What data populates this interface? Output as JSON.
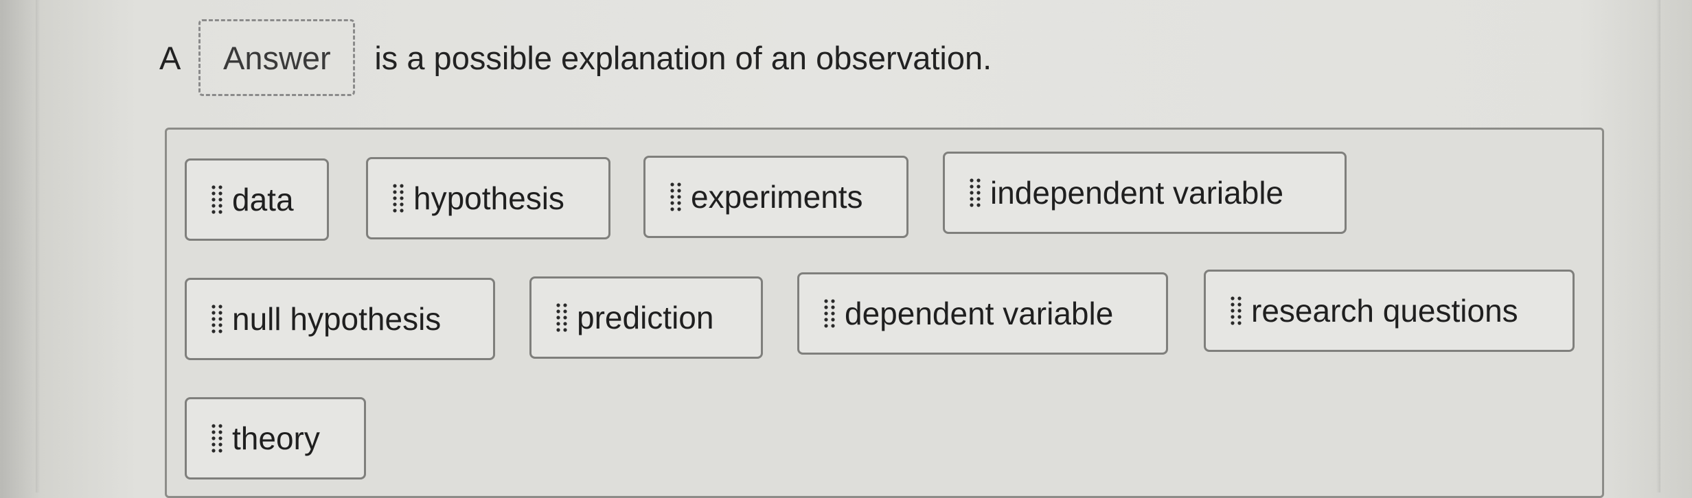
{
  "question": {
    "prefix": "A",
    "answer_placeholder": "Answer",
    "suffix": "is a possible explanation of an observation."
  },
  "answer_bank": {
    "choices": [
      {
        "label": "data"
      },
      {
        "label": "hypothesis"
      },
      {
        "label": "experiments"
      },
      {
        "label": "independent variable"
      },
      {
        "label": "null hypothesis"
      },
      {
        "label": "prediction"
      },
      {
        "label": "dependent variable"
      },
      {
        "label": "research questions"
      },
      {
        "label": "theory"
      }
    ],
    "grip_icon": "drag-handle-icon"
  },
  "colors": {
    "chip_border": "#7f7f7c",
    "bank_border": "#8c8c88",
    "slot_border": "#8a8a8a"
  }
}
